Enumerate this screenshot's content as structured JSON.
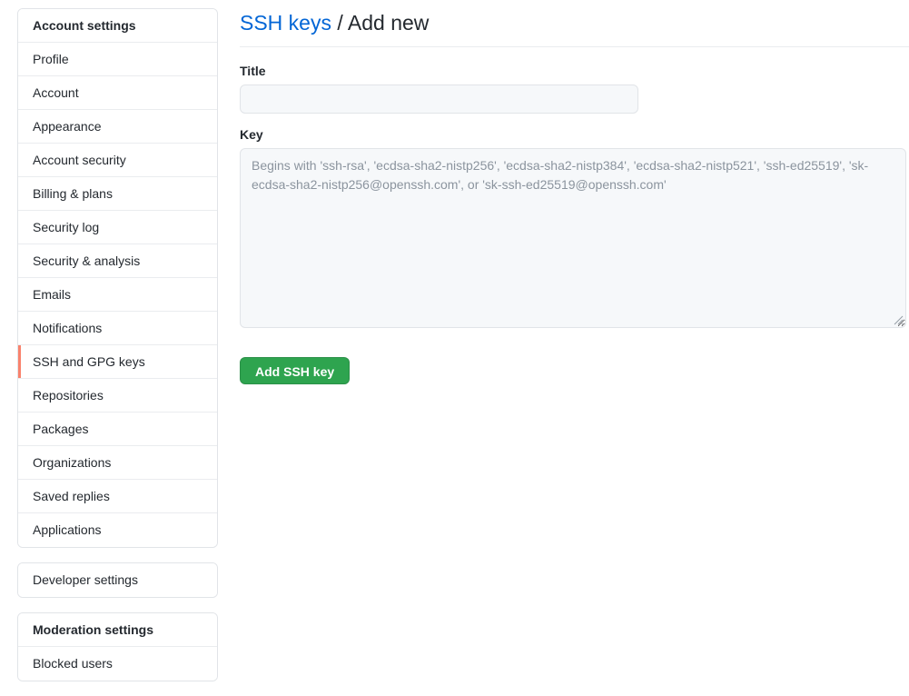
{
  "sidebar": {
    "panels": [
      {
        "name": "account-settings",
        "items": [
          {
            "label": "Account settings",
            "type": "header",
            "active": false
          },
          {
            "label": "Profile",
            "type": "link",
            "active": false
          },
          {
            "label": "Account",
            "type": "link",
            "active": false
          },
          {
            "label": "Appearance",
            "type": "link",
            "active": false
          },
          {
            "label": "Account security",
            "type": "link",
            "active": false
          },
          {
            "label": "Billing & plans",
            "type": "link",
            "active": false
          },
          {
            "label": "Security log",
            "type": "link",
            "active": false
          },
          {
            "label": "Security & analysis",
            "type": "link",
            "active": false
          },
          {
            "label": "Emails",
            "type": "link",
            "active": false
          },
          {
            "label": "Notifications",
            "type": "link",
            "active": false
          },
          {
            "label": "SSH and GPG keys",
            "type": "link",
            "active": true
          },
          {
            "label": "Repositories",
            "type": "link",
            "active": false
          },
          {
            "label": "Packages",
            "type": "link",
            "active": false
          },
          {
            "label": "Organizations",
            "type": "link",
            "active": false
          },
          {
            "label": "Saved replies",
            "type": "link",
            "active": false
          },
          {
            "label": "Applications",
            "type": "link",
            "active": false
          }
        ]
      },
      {
        "name": "developer-settings",
        "items": [
          {
            "label": "Developer settings",
            "type": "link",
            "active": false
          }
        ]
      },
      {
        "name": "moderation-settings",
        "items": [
          {
            "label": "Moderation settings",
            "type": "header",
            "active": false
          },
          {
            "label": "Blocked users",
            "type": "link",
            "active": false
          }
        ]
      }
    ]
  },
  "header": {
    "breadcrumb_link": "SSH keys",
    "breadcrumb_separator": "/",
    "breadcrumb_current": "Add new"
  },
  "form": {
    "title_label": "Title",
    "title_value": "",
    "title_placeholder": "",
    "key_label": "Key",
    "key_value": "",
    "key_placeholder": "Begins with 'ssh-rsa', 'ecdsa-sha2-nistp256', 'ecdsa-sha2-nistp384', 'ecdsa-sha2-nistp521', 'ssh-ed25519', 'sk-ecdsa-sha2-nistp256@openssh.com', or 'sk-ssh-ed25519@openssh.com'",
    "submit_label": "Add SSH key"
  },
  "colors": {
    "accent_link": "#0366d6",
    "active_indicator": "#f9826c",
    "primary_button": "#2ea44f",
    "field_background": "#f6f8fa",
    "border": "#e1e4e8",
    "text": "#24292f",
    "placeholder": "#8b949e"
  }
}
